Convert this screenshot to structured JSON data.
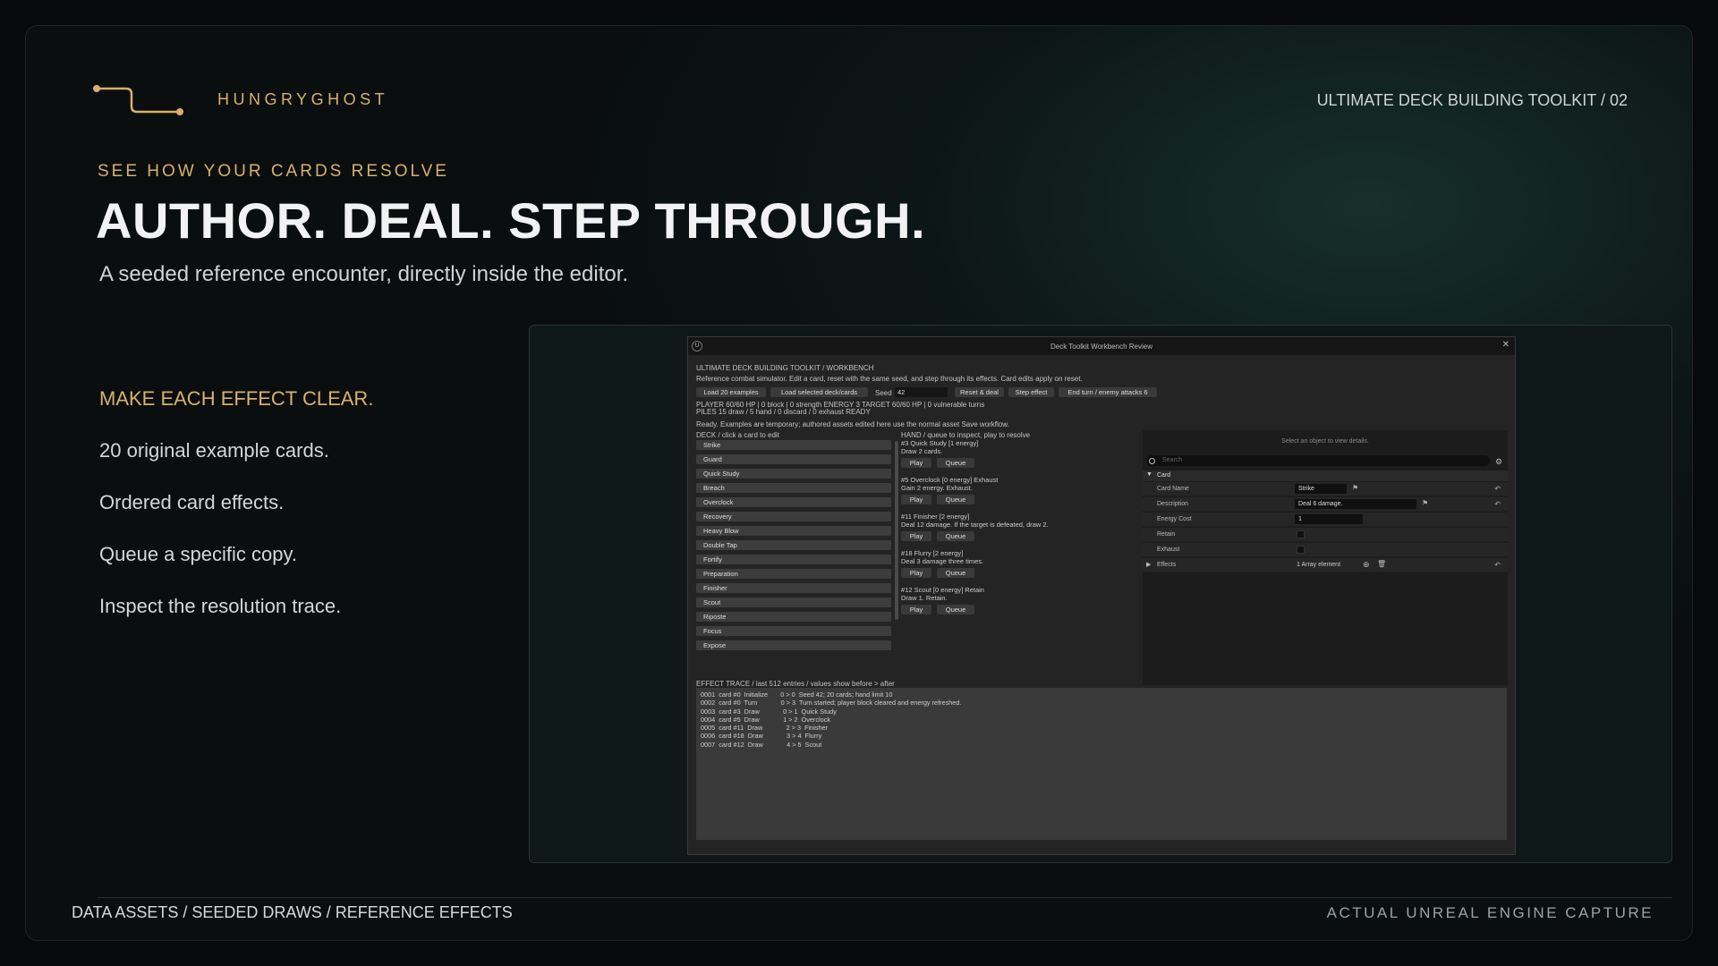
{
  "brand": {
    "name": "HUNGRYGHOST",
    "accent": "#d7b16a"
  },
  "header": {
    "series": "ULTIMATE DECK BUILDING TOOLKIT / 02"
  },
  "hero": {
    "eyebrow": "SEE HOW YOUR CARDS RESOLVE",
    "title": "AUTHOR. DEAL. STEP THROUGH.",
    "subtitle": "A seeded reference encounter, directly inside the editor."
  },
  "features": {
    "title": "MAKE EACH EFFECT CLEAR.",
    "items": [
      "20 original example cards.",
      "Ordered card effects.",
      "Queue a specific copy.",
      "Inspect the resolution trace."
    ]
  },
  "footer": {
    "left": "DATA ASSETS / SEEDED DRAWS / REFERENCE EFFECTS",
    "right": "ACTUAL UNREAL ENGINE CAPTURE"
  },
  "editor": {
    "window_title": "Deck Toolkit Workbench Review",
    "logo": "U",
    "close": "✕",
    "breadcrumb": "ULTIMATE DECK BUILDING TOOLKIT  /  WORKBENCH",
    "intro": "Reference combat simulator. Edit a card, reset with the same seed, and step through its effects. Card edits apply on reset.",
    "toolbar": {
      "load_examples": "Load 20 examples",
      "load_selected": "Load selected deck/cards",
      "seed_label": "Seed",
      "seed_value": "42",
      "reset_deal": "Reset & deal",
      "step_effect": "Step effect",
      "end_turn": "End turn / enemy attacks 6"
    },
    "status": {
      "player": "PLAYER  60/60 HP | 0 block | 0 strength    ENERGY  3    TARGET  60/60 HP | 0 vulnerable turns",
      "piles": "PILES  15 draw / 5 hand / 0 discard / 0 exhaust    READY",
      "ready": "Ready. Examples are temporary; authored assets edited here use the normal asset Save workflow."
    },
    "deck": {
      "header": "DECK  /  click a card to edit",
      "cards": [
        "Strike",
        "Guard",
        "Quick Study",
        "Breach",
        "Overclock",
        "Recovery",
        "Heavy Blow",
        "Double Tap",
        "Fortify",
        "Preparation",
        "Finisher",
        "Scout",
        "Riposte",
        "Focus",
        "Expose"
      ]
    },
    "hand": {
      "header": "HAND  /  queue to inspect, play to resolve",
      "play_label": "Play",
      "queue_label": "Queue",
      "cards": [
        {
          "title": "#3  Quick Study  [1 energy]",
          "text": "Draw 2 cards."
        },
        {
          "title": "#5  Overclock  [0 energy]  Exhaust",
          "text": "Gain 2 energy. Exhaust."
        },
        {
          "title": "#11  Finisher  [2 energy]",
          "text": "Deal 12 damage. If the target is defeated, draw 2."
        },
        {
          "title": "#18  Flurry  [2 energy]",
          "text": "Deal 3 damage three times."
        },
        {
          "title": "#12  Scout  [0 energy]  Retain",
          "text": "Draw 1. Retain."
        }
      ]
    },
    "details": {
      "hint": "Select an object to view details.",
      "search_placeholder": "Search",
      "category": "Card",
      "props": {
        "card_name_label": "Card Name",
        "card_name_value": "Strike",
        "description_label": "Description",
        "description_value": "Deal 6 damage.",
        "energy_label": "Energy Cost",
        "energy_value": "1",
        "retain_label": "Retain",
        "exhaust_label": "Exhaust",
        "effects_label": "Effects",
        "effects_value": "1 Array element"
      }
    },
    "trace": {
      "header": "EFFECT TRACE  /  last 512 entries  /  values show before > after",
      "lines": [
        "0001  card #0  Initialize       0 > 0  Seed 42; 20 cards; hand limit 10",
        "0002  card #0  Turn             0 > 3  Turn started; player block cleared and energy refreshed.",
        "0003  card #3  Draw             0 > 1  Quick Study",
        "0004  card #5  Draw             1 > 2  Overclock",
        "0005  card #11  Draw             2 > 3  Finisher",
        "0006  card #18  Draw             3 > 4  Flurry",
        "0007  card #12  Draw             4 > 5  Scout"
      ]
    }
  }
}
